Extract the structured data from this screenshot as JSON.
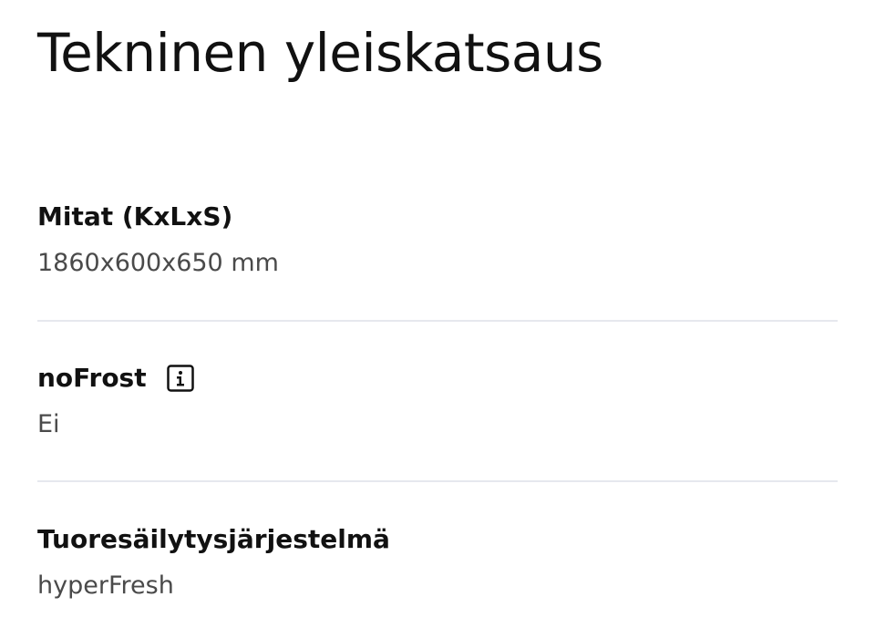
{
  "page": {
    "title": "Tekninen yleiskatsaus"
  },
  "specs": [
    {
      "label": "Mitat (KxLxS)",
      "value": "1860x600x650 mm"
    },
    {
      "label": "noFrost",
      "value": "Ei",
      "has_info_icon": true,
      "info_icon": "info-icon"
    },
    {
      "label": "Tuoresäilytysjärjestelmä",
      "value": "hyperFresh"
    }
  ],
  "colors": {
    "text": "#111111",
    "value_text": "#4a4a4a",
    "divider": "#e6e8ee"
  }
}
